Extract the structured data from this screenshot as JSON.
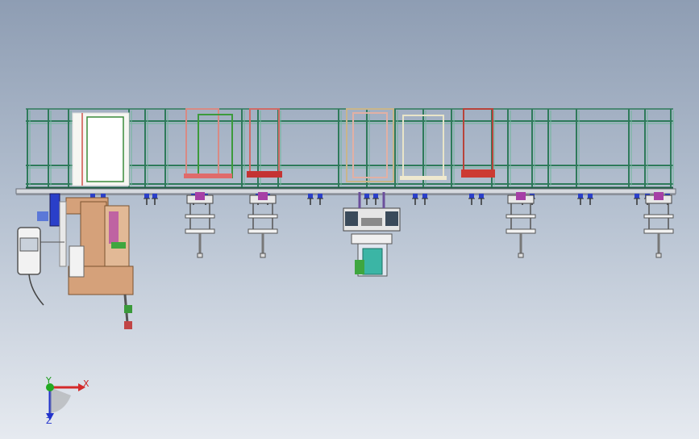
{
  "view": {
    "background_top": "#8e9db3",
    "background_bottom": "#e6eaf0",
    "frame_color": "#2e7a5a",
    "frame_highlight": "#6fb69a"
  },
  "triad": {
    "x_label": "X",
    "y_label": "Y",
    "z_label": "Z",
    "x_color": "#d42a2a",
    "y_color": "#22aa22",
    "z_color": "#2233cc"
  },
  "components": [
    "gantry-frame",
    "base-rail",
    "loading-station",
    "control-cabinet",
    "pick-head-1",
    "pick-head-2",
    "press-unit",
    "pick-head-3",
    "pick-head-4",
    "stop-fixture-red",
    "stop-fixture-pink"
  ]
}
